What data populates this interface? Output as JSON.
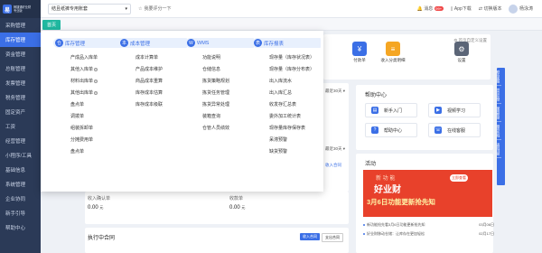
{
  "sidebar": {
    "logo_mark": "易",
    "logo_title": "畅捷通好业财",
    "logo_subtitle": "专业版",
    "items": [
      {
        "label": "采购管理"
      },
      {
        "label": "库存管理"
      },
      {
        "label": "资金管理"
      },
      {
        "label": "总账管理"
      },
      {
        "label": "发票管理"
      },
      {
        "label": "税务管理"
      },
      {
        "label": "固定资产"
      },
      {
        "label": "工资"
      },
      {
        "label": "经营管理"
      },
      {
        "label": "小程序/工具"
      },
      {
        "label": "基础信息"
      },
      {
        "label": "系统管理"
      },
      {
        "label": "企业协同"
      },
      {
        "label": "新手引导"
      },
      {
        "label": "帮助中心"
      }
    ]
  },
  "topbar": {
    "company": "结且纸裤专用账套",
    "favorite": "我要评分一下",
    "help_label": "消息",
    "help_badge": "99+",
    "app_download": "App下载",
    "switch": "切换版本",
    "username": "杨泳涛"
  },
  "tabs": {
    "home": "首页"
  },
  "mega_menu": {
    "columns": [
      {
        "title": "库存管理",
        "icon": "仓",
        "items": [
          {
            "label": "产成品入库单",
            "help": false
          },
          {
            "label": "其他入库单",
            "help": true
          },
          {
            "label": "材料出库单",
            "help": true
          },
          {
            "label": "其他出库单",
            "help": true
          },
          {
            "label": "盘点单",
            "help": false
          },
          {
            "label": "调拨单",
            "help": false
          },
          {
            "label": "组装拆卸单",
            "help": false
          },
          {
            "label": "分摊费用单",
            "help": false
          },
          {
            "label": "盘点单",
            "help": false
          }
        ]
      },
      {
        "title": "成本管理",
        "icon": "本",
        "items": [
          {
            "label": "成本计算单",
            "help": false
          },
          {
            "label": "产品成本维护",
            "help": false
          },
          {
            "label": "商品成本重算",
            "help": false
          },
          {
            "label": "库存成本估算",
            "help": false
          },
          {
            "label": "库存成本级联",
            "help": false
          }
        ]
      },
      {
        "title": "WMS",
        "icon": "W",
        "items": [
          {
            "label": "功能说明",
            "help": false
          },
          {
            "label": "仓储信息",
            "help": false
          },
          {
            "label": "拣货策略规划",
            "help": false
          },
          {
            "label": "拣货任务管理",
            "help": false
          },
          {
            "label": "拣货异常处理",
            "help": false
          },
          {
            "label": "装箱查询",
            "help": false
          },
          {
            "label": "仓管人员绩效",
            "help": false
          }
        ]
      },
      {
        "title": "库存报表",
        "icon": "表",
        "items": [
          {
            "label": "现存量（库存状况表）",
            "help": false
          },
          {
            "label": "现存量（库存分布表）",
            "help": false
          },
          {
            "label": "出入库流水",
            "help": false
          },
          {
            "label": "出入库汇总",
            "help": false
          },
          {
            "label": "收发存汇总表",
            "help": false
          },
          {
            "label": "委外加工统计表",
            "help": false
          },
          {
            "label": "现存量库存保存表",
            "help": false
          },
          {
            "label": "呆滞预警",
            "help": false
          },
          {
            "label": "缺货预警",
            "help": false
          }
        ]
      }
    ]
  },
  "dashboard": {
    "quick_label_1": "付款单",
    "quick_label_2": "收入分类明细",
    "quick_label_3": "设置",
    "link_rule": "首页自定义设置",
    "days_1": "最近30天",
    "days_2": "最近30天",
    "metric_a_label": "收入确认单",
    "metric_a_value": "0.00",
    "metric_a_unit": "元",
    "metric_b_label": "收款单",
    "metric_b_value": "0.00",
    "metric_b_unit": "元",
    "side_label": "收入合同",
    "exec_title": "执行中合同",
    "exec_btn_1": "收入合同",
    "exec_btn_2": "支出合同"
  },
  "help_center": {
    "title": "帮助中心",
    "buttons": [
      "新手入门",
      "视频学习",
      "帮助中心",
      "在线客服"
    ]
  },
  "activity": {
    "title": "活动",
    "banner_line1": "新 功 能",
    "banner_line2": "好业财",
    "banner_line3": "3月6日功能更新抢先知",
    "banner_tag": "立即查看",
    "news": [
      {
        "text": "新功能抢先看3月6日功能更新抢先知",
        "date": "03月06日"
      },
      {
        "text": "好业财移动仓储：让库存在更加轻松",
        "date": "02月17日"
      }
    ]
  },
  "right_rail": [
    "联系客服",
    "意见反馈",
    "使用帮助",
    "服务热线",
    "返回顶部"
  ],
  "colors": {
    "sidebar": "#2b3a57",
    "accent": "#3b6fe6",
    "home_tab": "#20b8a0",
    "banner": "#e8412b"
  }
}
